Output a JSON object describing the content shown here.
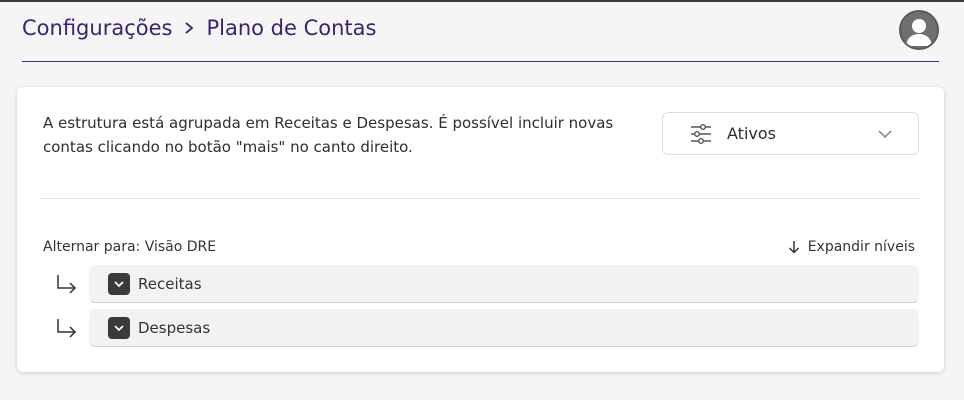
{
  "header": {
    "breadcrumb": [
      {
        "label": "Configurações"
      },
      {
        "label": "Plano de Contas"
      }
    ],
    "avatar_icon": "user-avatar-icon"
  },
  "card": {
    "description": "A estrutura está agrupada em Receitas e Despesas. É possível incluir novas contas clicando no botão \"mais\" no canto direito.",
    "filter": {
      "icon": "sliders-icon",
      "selected": "Ativos",
      "chevron_icon": "chevron-down-icon"
    },
    "toggle_view_label": "Alternar para: Visão DRE",
    "expand_label": "Expandir níveis",
    "groups": [
      {
        "label": "Receitas"
      },
      {
        "label": "Despesas"
      }
    ]
  },
  "colors": {
    "accent": "#3d2370",
    "header_rule": "#4b2a7a",
    "checkbox": "#3a3a3a",
    "row_bg": "#f2f2f2"
  }
}
